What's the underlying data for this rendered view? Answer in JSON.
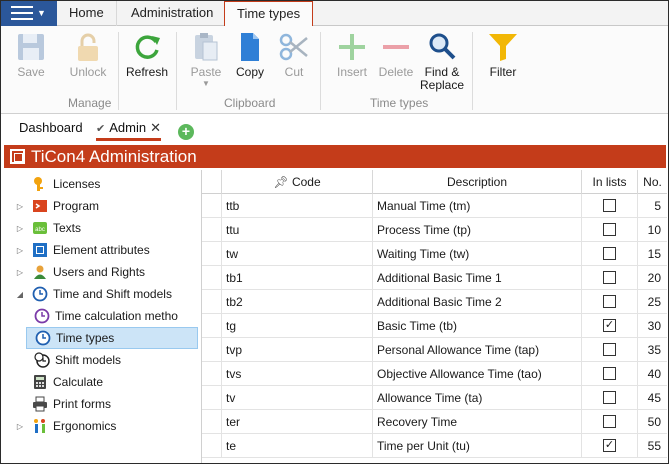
{
  "ribbon_tabs": [
    {
      "label": "Home"
    },
    {
      "label": "Administration"
    },
    {
      "label": "Time types",
      "active": true
    }
  ],
  "ribbon": {
    "groups": [
      {
        "label": "Manage",
        "buttons": [
          {
            "label": "Save",
            "icon": "save-icon",
            "enabled": false
          },
          {
            "label": "Unlock",
            "icon": "lock-icon",
            "enabled": false
          }
        ]
      },
      {
        "label": "",
        "buttons": [
          {
            "label": "Refresh",
            "icon": "refresh-icon",
            "enabled": true
          }
        ]
      },
      {
        "label": "Clipboard",
        "buttons": [
          {
            "label": "Paste",
            "icon": "paste-icon",
            "enabled": false
          },
          {
            "label": "Copy",
            "icon": "copy-icon",
            "enabled": true
          },
          {
            "label": "Cut",
            "icon": "cut-icon",
            "enabled": false
          }
        ]
      },
      {
        "label": "Time types",
        "buttons": [
          {
            "label": "Insert",
            "icon": "insert-icon",
            "enabled": false
          },
          {
            "label": "Delete",
            "icon": "delete-icon",
            "enabled": false
          },
          {
            "label": "Find &\nReplace",
            "icon": "find-replace-icon",
            "enabled": true
          }
        ]
      },
      {
        "label": "",
        "buttons": [
          {
            "label": "Filter",
            "icon": "filter-icon",
            "enabled": true
          }
        ]
      }
    ]
  },
  "doc_tabs": [
    {
      "label": "Dashboard"
    },
    {
      "label": "Admin",
      "active": true
    }
  ],
  "title": "TiCon4 Administration",
  "tree": [
    {
      "label": "Licenses",
      "icon": "key-icon",
      "level": 0,
      "expander": ""
    },
    {
      "label": "Program",
      "icon": "program-icon",
      "level": 0,
      "expander": "▷"
    },
    {
      "label": "Texts",
      "icon": "texts-icon",
      "level": 0,
      "expander": "▷"
    },
    {
      "label": "Element attributes",
      "icon": "attributes-icon",
      "level": 0,
      "expander": "▷"
    },
    {
      "label": "Users and Rights",
      "icon": "user-icon",
      "level": 0,
      "expander": "▷"
    },
    {
      "label": "Time and Shift models",
      "icon": "clock-icon",
      "level": 0,
      "expander": "◢"
    },
    {
      "label": "Time calculation metho",
      "icon": "clock-purple-icon",
      "level": 1,
      "expander": ""
    },
    {
      "label": "Time types",
      "icon": "clock-icon",
      "level": 1,
      "expander": "",
      "selected": true
    },
    {
      "label": "Shift models",
      "icon": "shift-icon",
      "level": 1,
      "expander": ""
    },
    {
      "label": "Calculate",
      "icon": "calculator-icon",
      "level": 0,
      "expander": ""
    },
    {
      "label": "Print forms",
      "icon": "printer-icon",
      "level": 0,
      "expander": ""
    },
    {
      "label": "Ergonomics",
      "icon": "ergonomics-icon",
      "level": 0,
      "expander": "▷"
    }
  ],
  "grid": {
    "columns": [
      "Code",
      "Description",
      "In lists",
      "No."
    ],
    "rows": [
      {
        "code": "ttb",
        "description": "Manual Time (tm)",
        "in_lists": false,
        "no": "5"
      },
      {
        "code": "ttu",
        "description": "Process Time (tp)",
        "in_lists": false,
        "no": "10"
      },
      {
        "code": "tw",
        "description": "Waiting Time (tw)",
        "in_lists": false,
        "no": "15"
      },
      {
        "code": "tb1",
        "description": "Additional Basic Time 1",
        "in_lists": false,
        "no": "20"
      },
      {
        "code": "tb2",
        "description": "Additional Basic Time 2",
        "in_lists": false,
        "no": "25"
      },
      {
        "code": "tg",
        "description": "Basic Time (tb)",
        "in_lists": true,
        "no": "30"
      },
      {
        "code": "tvp",
        "description": "Personal Allowance Time (tap)",
        "in_lists": false,
        "no": "35"
      },
      {
        "code": "tvs",
        "description": "Objective Allowance Time (tao)",
        "in_lists": false,
        "no": "40"
      },
      {
        "code": "tv",
        "description": "Allowance Time (ta)",
        "in_lists": false,
        "no": "45"
      },
      {
        "code": "ter",
        "description": "Recovery Time",
        "in_lists": false,
        "no": "50"
      },
      {
        "code": "te",
        "description": "Time per Unit (tu)",
        "in_lists": true,
        "no": "55"
      }
    ]
  },
  "colors": {
    "accent": "#c43c1a",
    "menu": "#2b579a",
    "selection": "#cce4f7"
  }
}
